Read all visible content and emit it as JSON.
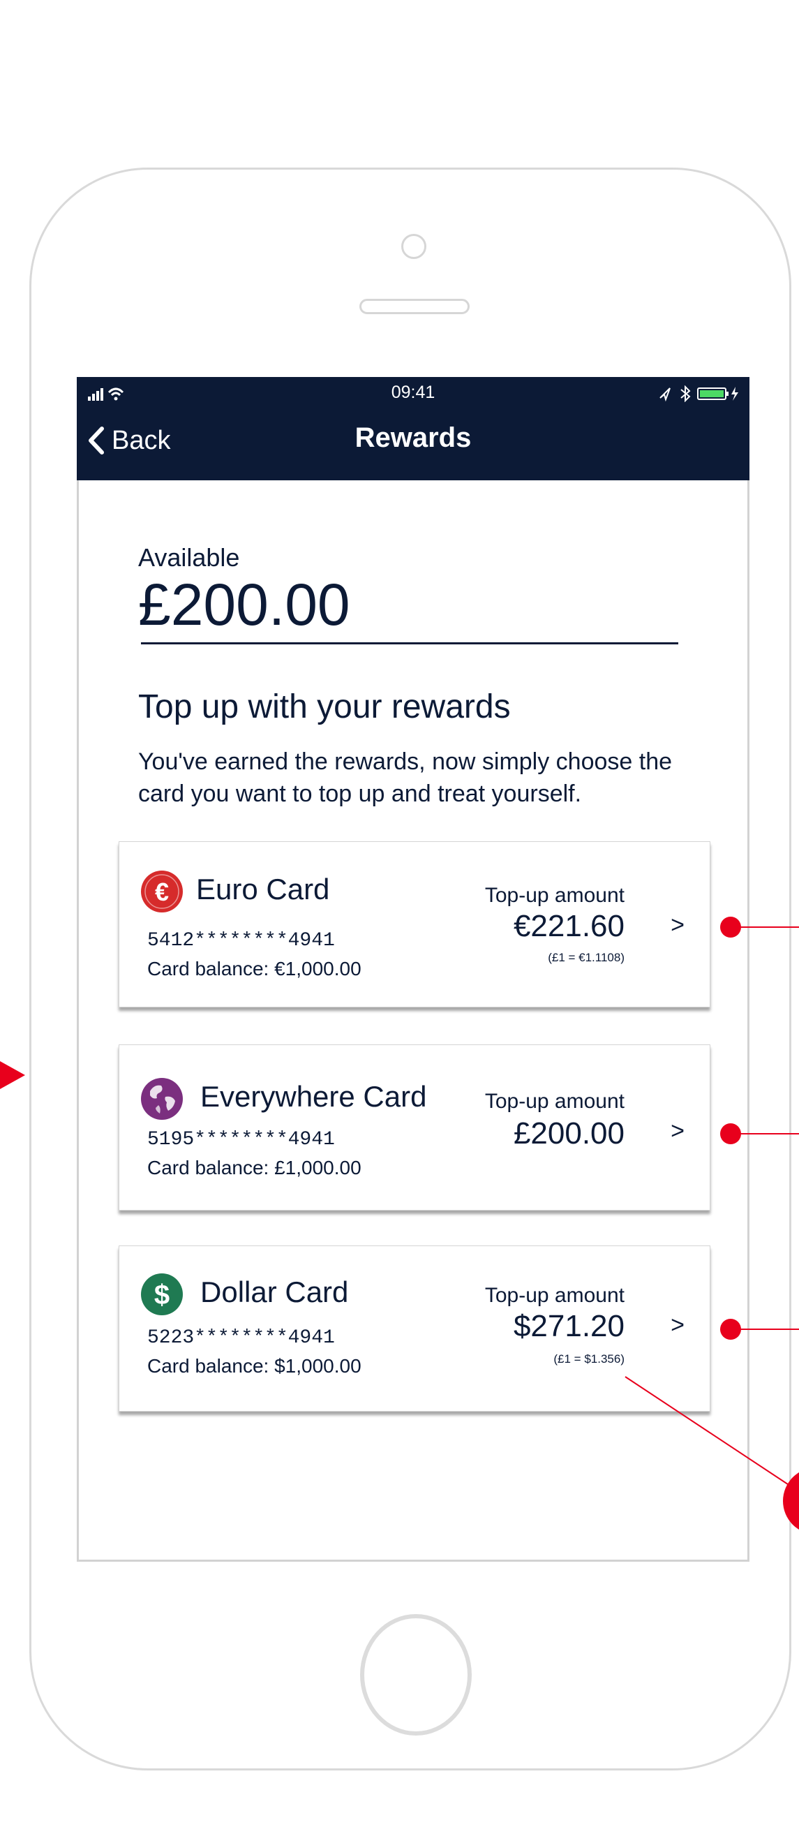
{
  "status_bar": {
    "time": "09:41"
  },
  "nav": {
    "back_label": "Back",
    "title": "Rewards"
  },
  "balance": {
    "label": "Available",
    "amount": "£200.00"
  },
  "section": {
    "title": "Top up with your rewards",
    "description": "You've earned the rewards, now simply choose the card you want to top up and treat yourself."
  },
  "cards": [
    {
      "name": "Euro Card",
      "number": "5412********4941",
      "balance": "Card balance: €1,000.00",
      "topup_label": "Top-up amount",
      "topup_amount": "€221.60",
      "fx_rate": "(£1 = €1.1108)",
      "chevron": ">",
      "icon": "euro-icon",
      "icon_color": "#d62b2b"
    },
    {
      "name": "Everywhere Card",
      "number": "5195********4941",
      "balance": "Card balance: £1,000.00",
      "topup_label": "Top-up amount",
      "topup_amount": "£200.00",
      "fx_rate": "",
      "chevron": ">",
      "icon": "globe-icon",
      "icon_color": "#7b2f7f"
    },
    {
      "name": "Dollar Card",
      "number": "5223********4941",
      "balance": "Card balance: $1,000.00",
      "topup_label": "Top-up amount",
      "topup_amount": "$271.20",
      "fx_rate": "(£1 = $1.356)",
      "chevron": ">",
      "icon": "dollar-icon",
      "icon_color": "#1f7a52"
    }
  ],
  "colors": {
    "navy": "#0c1a36",
    "annotation_red": "#e8001c"
  }
}
